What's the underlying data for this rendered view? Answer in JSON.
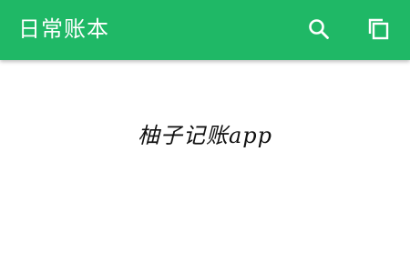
{
  "app_bar": {
    "title": "日常账本",
    "background": "#1fb866",
    "actions": [
      {
        "icon": "search-icon"
      },
      {
        "icon": "copy-icon"
      }
    ]
  },
  "content": {
    "watermark_text": "柚子记账app"
  }
}
